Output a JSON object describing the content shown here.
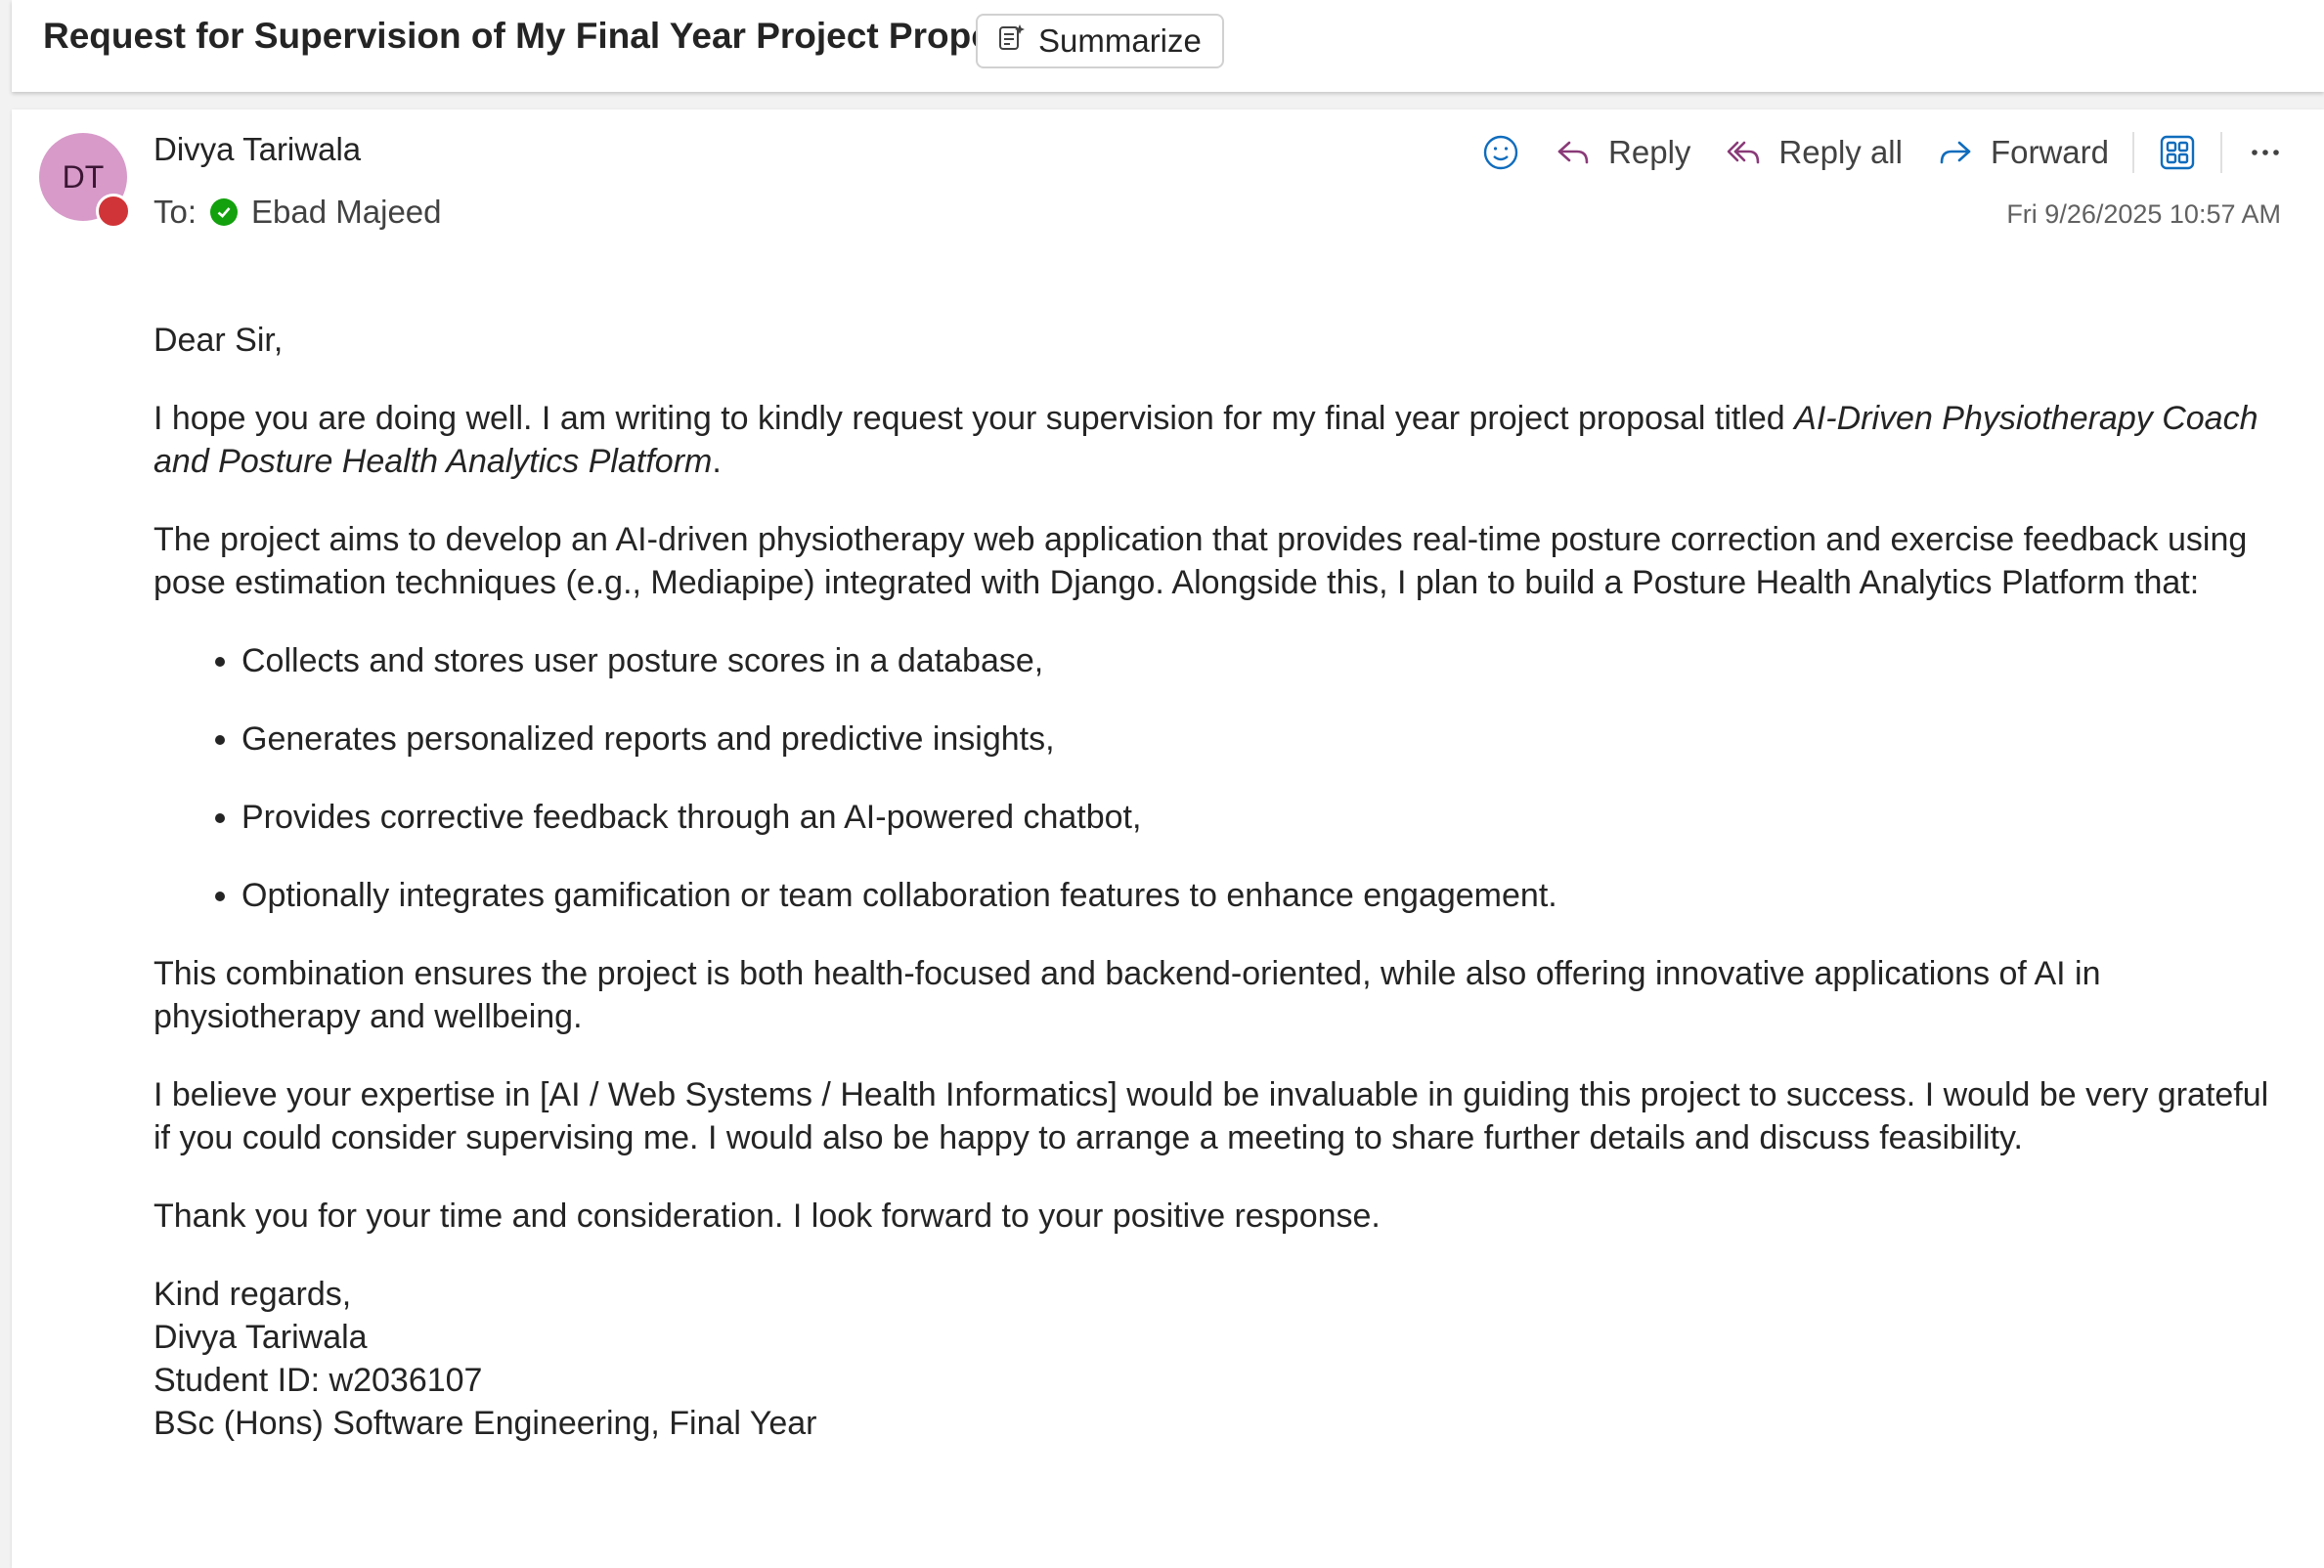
{
  "subject": "Request for Supervision of My Final Year Project Proposal",
  "summarize_label": "Summarize",
  "sender": {
    "initials": "DT",
    "name": "Divya Tariwala",
    "avatar_color": "#d79ac9",
    "presence_color": "#d13438"
  },
  "to": {
    "label": "To:",
    "recipient": "Ebad Majeed",
    "status_color": "#13a10e"
  },
  "actions": {
    "emoji_icon": "smiley-icon",
    "reply": "Reply",
    "reply_all": "Reply all",
    "forward": "Forward",
    "apps_icon": "apps-icon",
    "more_icon": "more-icon"
  },
  "timestamp": "Fri 9/26/2025 10:57 AM",
  "body": {
    "greeting": "Dear Sir,",
    "para1_text": "I hope you are doing well. I am writing to kindly request your supervision for my final year project proposal titled ",
    "para1_title": "AI-Driven Physiotherapy Coach and Posture Health Analytics Platform",
    "para1_end": ".",
    "para2": "The project aims to develop an AI-driven physiotherapy web application that provides real-time posture correction and exercise feedback using pose estimation techniques (e.g., Mediapipe) integrated with Django. Alongside this, I plan to build a Posture Health Analytics Platform that:",
    "bullets": [
      "Collects and stores user posture scores in a database,",
      "Generates personalized reports and predictive insights,",
      "Provides corrective feedback through an AI-powered chatbot,",
      "Optionally integrates gamification or team collaboration features to enhance engagement."
    ],
    "para3": "This combination ensures the project is both health-focused and backend-oriented, while also offering innovative applications of AI in physiotherapy and wellbeing.",
    "para4": "I believe your expertise in [AI / Web Systems / Health Informatics] would be invaluable in guiding this project to success. I would be very grateful if you could consider supervising me. I would also be happy to arrange a meeting to share further details and discuss feasibility.",
    "para5": "Thank you for your time and consideration. I look forward to your positive response.",
    "signature": [
      "Kind regards,",
      "Divya Tariwala",
      "Student ID: w2036107",
      "BSc (Hons) Software Engineering, Final Year"
    ]
  }
}
